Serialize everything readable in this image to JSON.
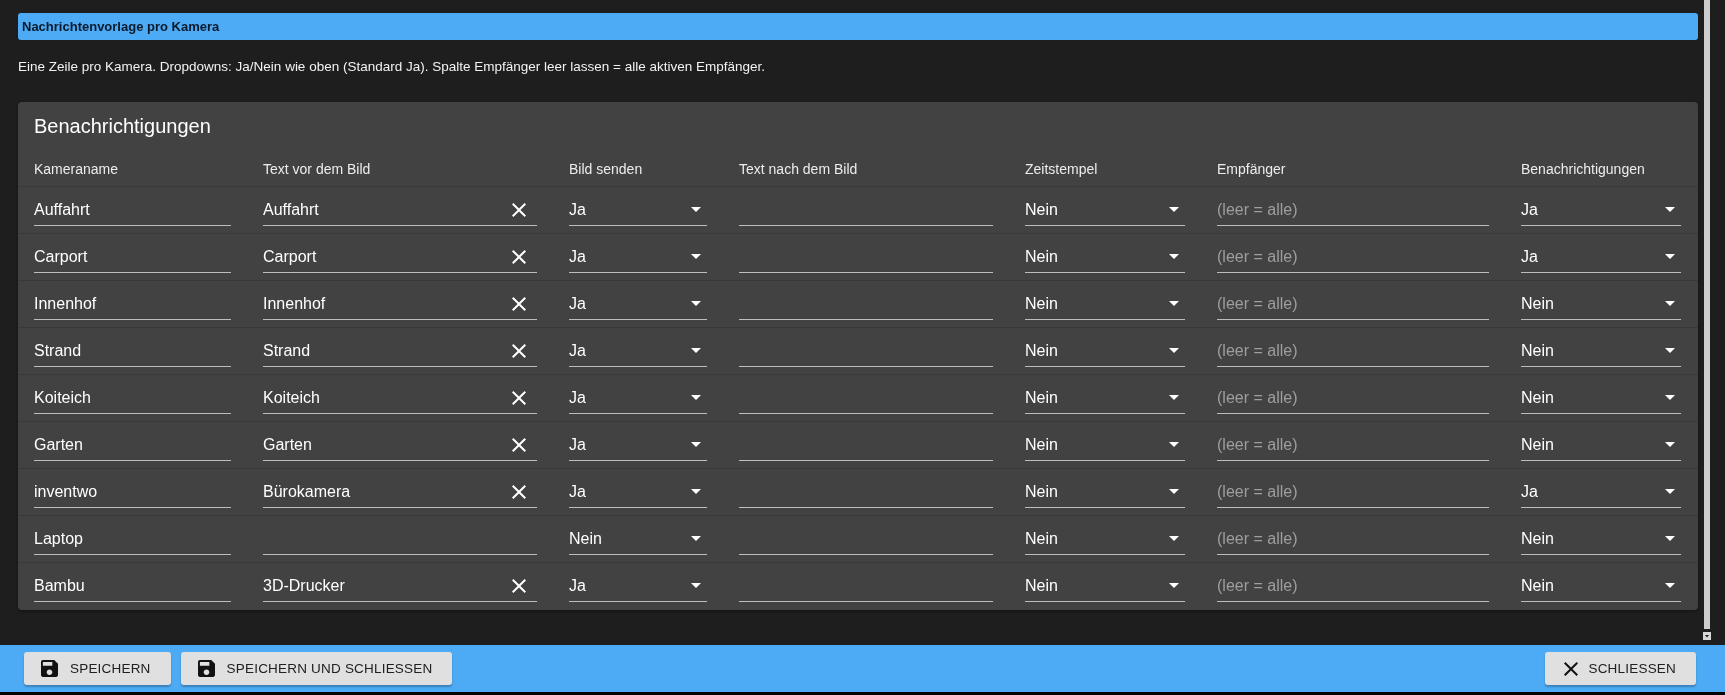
{
  "header": {
    "title": "Nachrichtenvorlage pro Kamera"
  },
  "description": "Eine Zeile pro Kamera. Dropdowns: Ja/Nein wie oben (Standard Ja). Spalte Empfänger leer lassen = alle aktiven Empfänger.",
  "table": {
    "title": "Benachrichtigungen",
    "columns": [
      {
        "label": "Kameraname",
        "kind": "text"
      },
      {
        "label": "Text vor dem Bild",
        "kind": "text",
        "clearable": true
      },
      {
        "label": "Bild senden",
        "kind": "select"
      },
      {
        "label": "Text nach dem Bild",
        "kind": "text"
      },
      {
        "label": "Zeitstempel",
        "kind": "select"
      },
      {
        "label": "Empfänger",
        "kind": "text"
      },
      {
        "label": "Benachrichtigungen",
        "kind": "select"
      }
    ],
    "rows": [
      {
        "camera_name": "Auffahrt",
        "text_before": "Auffahrt",
        "send_image": "Ja",
        "timestamp": "Nein",
        "recipients": {
          "placeholder": "(leer = alle)"
        },
        "notifications": "Ja"
      },
      {
        "camera_name": "Carport",
        "text_before": "Carport",
        "send_image": "Ja",
        "timestamp": "Nein",
        "recipients": {
          "placeholder": "(leer = alle)"
        },
        "notifications": "Ja"
      },
      {
        "camera_name": "Innenhof",
        "text_before": "Innenhof",
        "send_image": "Ja",
        "timestamp": "Nein",
        "recipients": {
          "placeholder": "(leer = alle)"
        },
        "notifications": "Nein"
      },
      {
        "camera_name": "Strand",
        "text_before": "Strand",
        "send_image": "Ja",
        "timestamp": "Nein",
        "recipients": {
          "placeholder": "(leer = alle)"
        },
        "notifications": "Nein"
      },
      {
        "camera_name": "Koiteich",
        "text_before": "Koiteich",
        "send_image": "Ja",
        "timestamp": "Nein",
        "recipients": {
          "placeholder": "(leer = alle)"
        },
        "notifications": "Nein"
      },
      {
        "camera_name": "Garten",
        "text_before": "Garten",
        "send_image": "Ja",
        "timestamp": "Nein",
        "recipients": {
          "placeholder": "(leer = alle)"
        },
        "notifications": "Nein"
      },
      {
        "camera_name": "inventwo",
        "text_before": "Bürokamera",
        "send_image": "Ja",
        "timestamp": "Nein",
        "recipients": {
          "placeholder": "(leer = alle)"
        },
        "notifications": "Ja"
      },
      {
        "camera_name": "Laptop",
        "send_image": "Nein",
        "timestamp": "Nein",
        "recipients": {
          "placeholder": "(leer = alle)"
        },
        "notifications": "Nein"
      },
      {
        "camera_name": "Bambu",
        "text_before": "3D-Drucker",
        "send_image": "Ja",
        "timestamp": "Nein",
        "recipients": {
          "placeholder": "(leer = alle)"
        },
        "notifications": "Nein"
      }
    ]
  },
  "actions": {
    "left": [
      {
        "label": "SPEICHERN",
        "kind": "save"
      },
      {
        "label": "SPEICHERN UND SCHLIESSEN",
        "kind": "save"
      }
    ],
    "right": [
      {
        "label": "SCHLIESSEN",
        "kind": "close"
      }
    ]
  }
}
